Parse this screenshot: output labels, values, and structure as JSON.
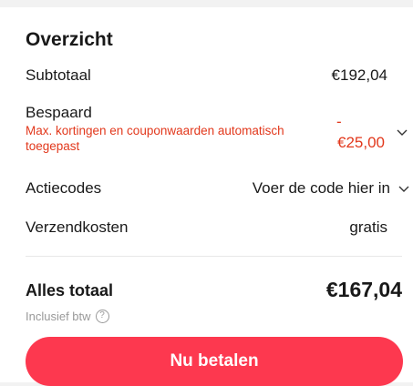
{
  "summary": {
    "title": "Overzicht",
    "subtotal_label": "Subtotaal",
    "subtotal_value": "€192,04",
    "saved_label": "Bespaard",
    "saved_note": "Max. kortingen en couponwaarden automatisch toegepast",
    "saved_value_sign": "-",
    "saved_value": "€25,00",
    "promo_label": "Actiecodes",
    "promo_action": "Voer de code hier in",
    "shipping_label": "Verzendkosten",
    "shipping_value": "gratis",
    "total_label": "Alles totaal",
    "total_value": "€167,04",
    "vat_note": "Inclusief btw",
    "help_glyph": "?",
    "pay_button": "Nu betalen"
  },
  "colors": {
    "accent": "#fd384f",
    "discount": "#e2381c",
    "muted": "#999999"
  },
  "icons": [
    "chevron-down-icon",
    "help-circle-icon"
  ]
}
